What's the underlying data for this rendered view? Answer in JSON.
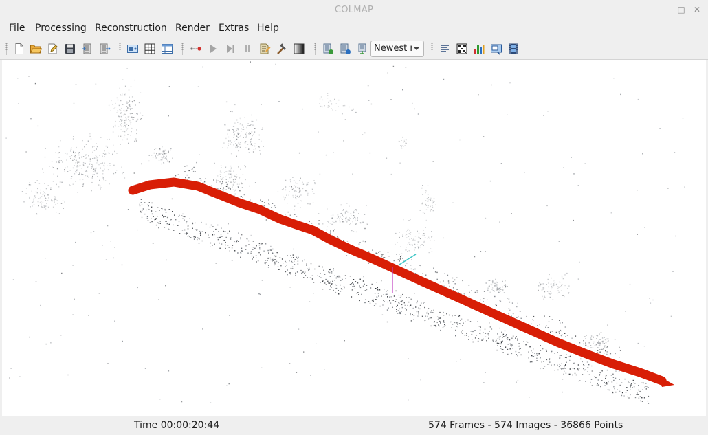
{
  "window": {
    "title": "COLMAP",
    "minimize_glyph": "–",
    "maximize_glyph": "□",
    "close_glyph": "✕"
  },
  "menu": {
    "items": [
      "File",
      "Processing",
      "Reconstruction",
      "Render",
      "Extras",
      "Help"
    ]
  },
  "toolbar": {
    "icons": [
      "new-project-icon",
      "open-project-icon",
      "edit-project-icon",
      "save-project-icon",
      "import-model-icon",
      "export-model-icon",
      "feature-extraction-icon",
      "feature-matching-icon",
      "database-management-icon",
      "automatic-reconstruction-icon",
      "start-reconstruction-icon",
      "step-reconstruction-icon",
      "pause-reconstruction-icon",
      "reconstruction-options-icon",
      "bundle-adjustment-icon",
      "dense-reconstruction-icon",
      "render-add-icon",
      "render-options-icon",
      "render-point-icon",
      "reconstruction-stats-icon",
      "match-matrix-icon",
      "log-icon",
      "grab-image-icon",
      "grab-movie-icon"
    ],
    "reconstruction_select": {
      "value": "Newest r",
      "options": [
        "Newest reconstruction"
      ]
    }
  },
  "viewport": {
    "description_colors": {
      "trajectory": "#d81e06",
      "points": "#5a5e63",
      "background": "#ffffff"
    }
  },
  "status": {
    "time": "Time 00:00:20:44",
    "counts": "574 Frames - 574 Images - 36866 Points"
  }
}
